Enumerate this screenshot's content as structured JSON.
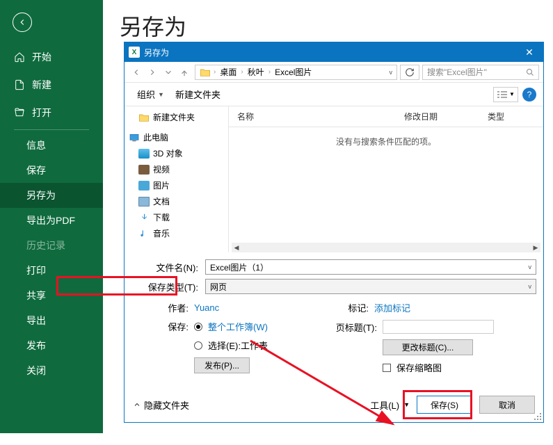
{
  "page_title": "另存为",
  "sidebar": {
    "items": [
      "开始",
      "新建",
      "打开"
    ],
    "subs": [
      "信息",
      "保存",
      "另存为",
      "导出为PDF",
      "历史记录",
      "打印",
      "共享",
      "导出",
      "发布",
      "关闭"
    ],
    "active": "另存为",
    "dim": "历史记录"
  },
  "dialog": {
    "title": "另存为",
    "breadcrumb": [
      "桌面",
      "秋叶",
      "Excel图片"
    ],
    "search_placeholder": "搜索\"Excel图片\"",
    "organize": "组织",
    "new_folder": "新建文件夹",
    "tree": [
      "新建文件夹",
      "此电脑",
      "3D 对象",
      "视频",
      "图片",
      "文档",
      "下载",
      "音乐"
    ],
    "columns": [
      "名称",
      "修改日期",
      "类型"
    ],
    "empty": "没有与搜索条件匹配的项。",
    "filename_label": "文件名(N):",
    "filename": "Excel图片（1）",
    "filetype_label": "保存类型(T):",
    "filetype": "网页",
    "author_label": "作者:",
    "author": "Yuanc",
    "tag_label": "标记:",
    "tag_placeholder": "添加标记",
    "save_label": "保存:",
    "radio_workbook": "整个工作簿(W)",
    "radio_sheet": "选择(E):工作表",
    "publish": "发布(P)...",
    "page_title_label": "页标题(T):",
    "change_title": "更改标题(C)...",
    "save_thumb": "保存缩略图",
    "hide_folders": "隐藏文件夹",
    "tools": "工具(L)",
    "save_btn": "保存(S)",
    "cancel_btn": "取消"
  }
}
